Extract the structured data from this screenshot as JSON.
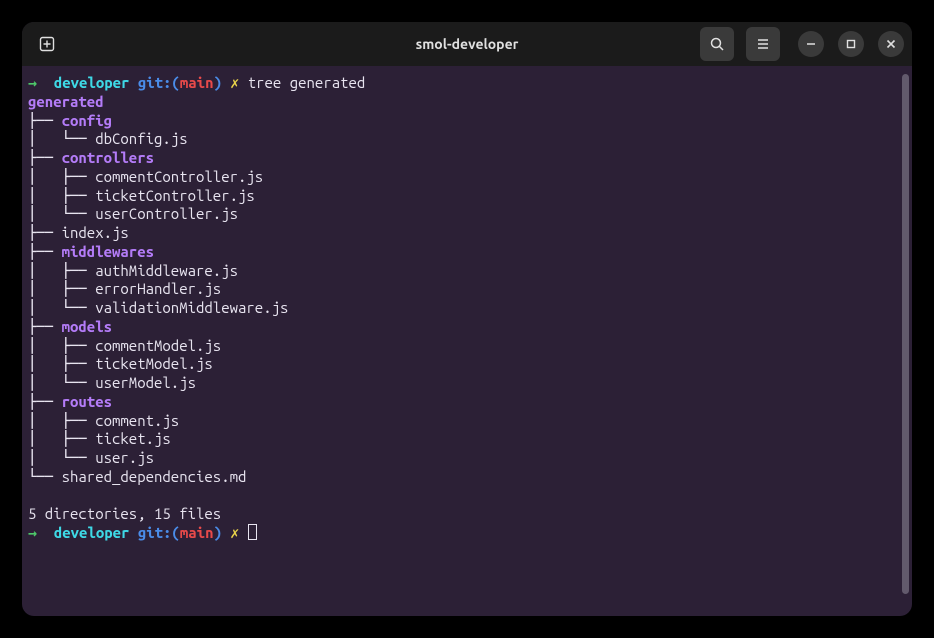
{
  "window": {
    "title": "smol-developer"
  },
  "prompt1": {
    "arrow": "→",
    "cwd": "developer",
    "git_label": "git:",
    "paren_open": "(",
    "branch": "main",
    "paren_close": ")",
    "glyph": "✗",
    "command": "tree generated"
  },
  "tree": {
    "root": "generated",
    "l1": {
      "pre": "├── ",
      "name": "config"
    },
    "l2": {
      "pre": "│   └── ",
      "name": "dbConfig.js"
    },
    "l3": {
      "pre": "├── ",
      "name": "controllers"
    },
    "l4": {
      "pre": "│   ├── ",
      "name": "commentController.js"
    },
    "l5": {
      "pre": "│   ├── ",
      "name": "ticketController.js"
    },
    "l6": {
      "pre": "│   └── ",
      "name": "userController.js"
    },
    "l7": {
      "pre": "├── ",
      "name": "index.js"
    },
    "l8": {
      "pre": "├── ",
      "name": "middlewares"
    },
    "l9": {
      "pre": "│   ├── ",
      "name": "authMiddleware.js"
    },
    "l10": {
      "pre": "│   ├── ",
      "name": "errorHandler.js"
    },
    "l11": {
      "pre": "│   └── ",
      "name": "validationMiddleware.js"
    },
    "l12": {
      "pre": "├── ",
      "name": "models"
    },
    "l13": {
      "pre": "│   ├── ",
      "name": "commentModel.js"
    },
    "l14": {
      "pre": "│   ├── ",
      "name": "ticketModel.js"
    },
    "l15": {
      "pre": "│   └── ",
      "name": "userModel.js"
    },
    "l16": {
      "pre": "├── ",
      "name": "routes"
    },
    "l17": {
      "pre": "│   ├── ",
      "name": "comment.js"
    },
    "l18": {
      "pre": "│   ├── ",
      "name": "ticket.js"
    },
    "l19": {
      "pre": "│   └── ",
      "name": "user.js"
    },
    "l20": {
      "pre": "└── ",
      "name": "shared_dependencies.md"
    }
  },
  "summary": "5 directories, 15 files",
  "prompt2": {
    "arrow": "→",
    "cwd": "developer",
    "git_label": "git:",
    "paren_open": "(",
    "branch": "main",
    "paren_close": ")",
    "glyph": "✗"
  }
}
